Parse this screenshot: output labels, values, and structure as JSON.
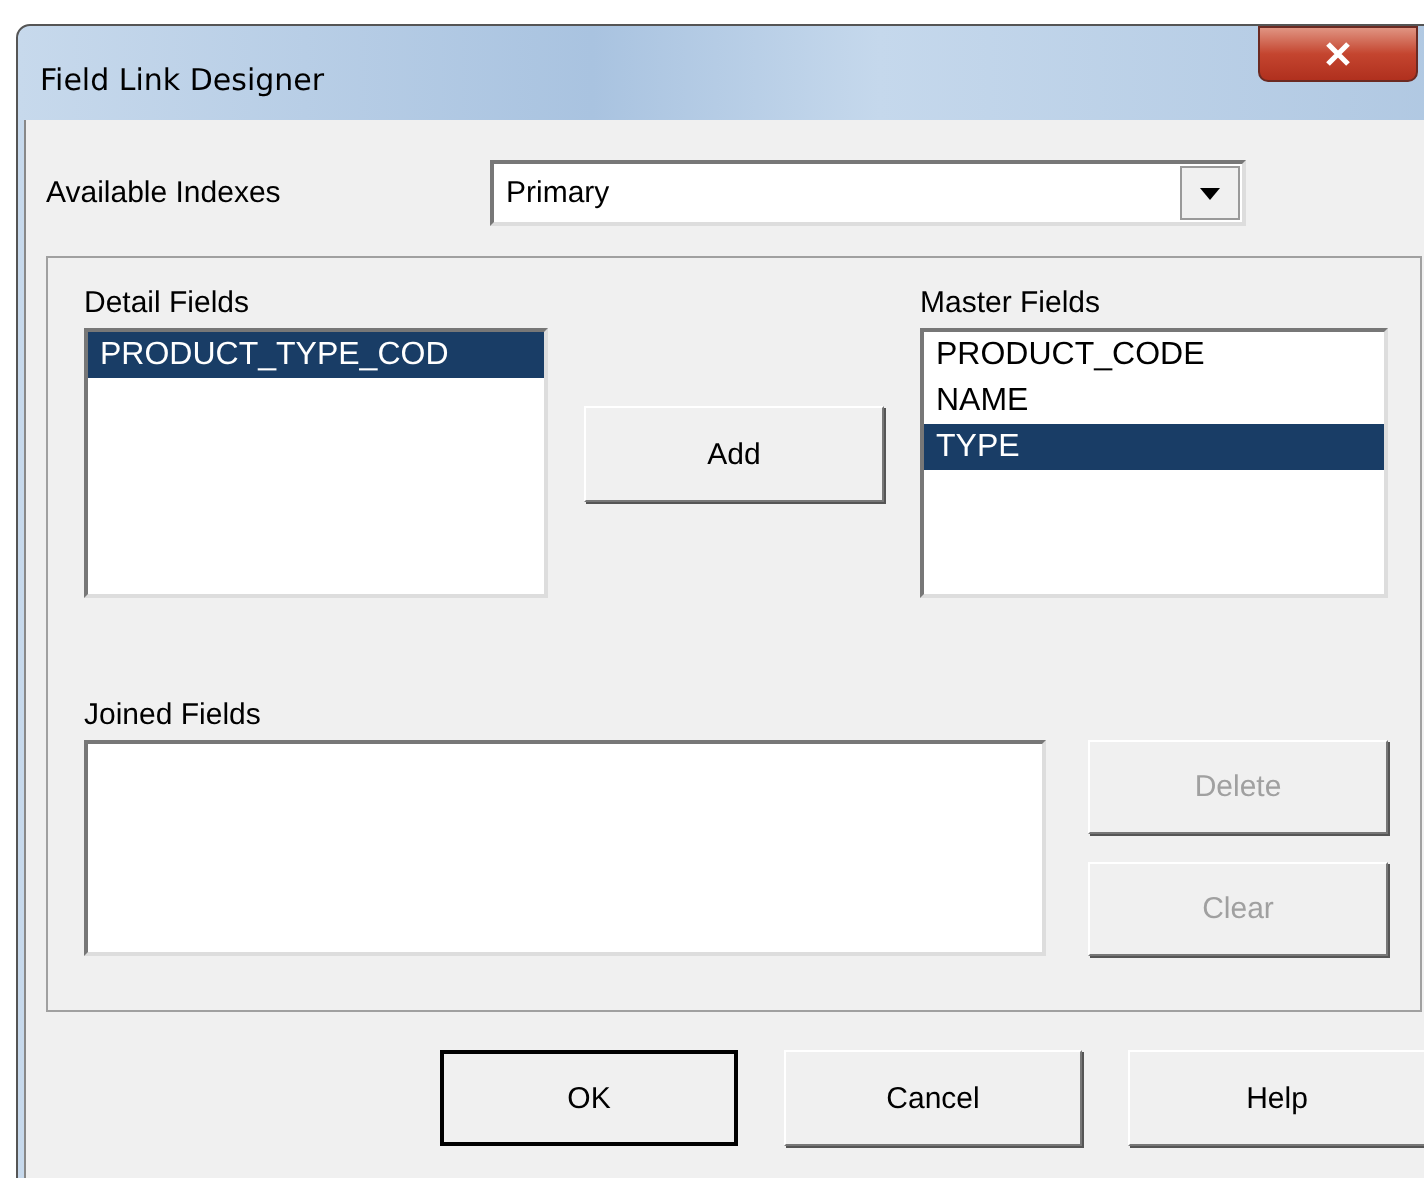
{
  "window": {
    "title": "Field Link Designer"
  },
  "available_indexes": {
    "label": "Available Indexes",
    "value": "Primary"
  },
  "detail_fields": {
    "label": "Detail Fields",
    "items": [
      {
        "text": "PRODUCT_TYPE_COD",
        "selected": true
      }
    ]
  },
  "add_button": {
    "label": "Add",
    "disabled": false
  },
  "master_fields": {
    "label": "Master Fields",
    "items": [
      {
        "text": "PRODUCT_CODE",
        "selected": false
      },
      {
        "text": "NAME",
        "selected": false
      },
      {
        "text": "TYPE",
        "selected": true
      }
    ]
  },
  "joined_fields": {
    "label": "Joined Fields"
  },
  "side_buttons": [
    {
      "label": "Delete",
      "disabled": true
    },
    {
      "label": "Clear",
      "disabled": true
    }
  ],
  "buttons": [
    {
      "label": "OK",
      "default": true
    },
    {
      "label": "Cancel",
      "default": false
    },
    {
      "label": "Help",
      "default": false
    }
  ]
}
